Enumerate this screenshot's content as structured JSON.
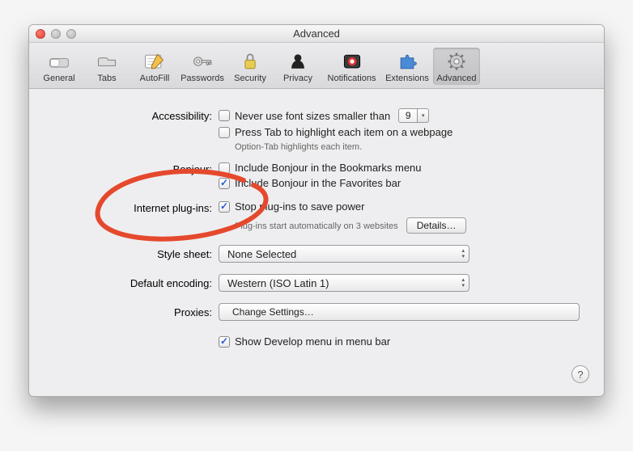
{
  "window": {
    "title": "Advanced"
  },
  "toolbar": {
    "items": [
      {
        "label": "General"
      },
      {
        "label": "Tabs"
      },
      {
        "label": "AutoFill"
      },
      {
        "label": "Passwords"
      },
      {
        "label": "Security"
      },
      {
        "label": "Privacy"
      },
      {
        "label": "Notifications"
      },
      {
        "label": "Extensions"
      },
      {
        "label": "Advanced"
      }
    ]
  },
  "sections": {
    "accessibility": {
      "label": "Accessibility:",
      "never_use_font_sizes": "Never use font sizes smaller than",
      "font_size_value": "9",
      "press_tab": "Press Tab to highlight each item on a webpage",
      "option_tab_note": "Option-Tab highlights each item."
    },
    "bonjour": {
      "label": "Bonjour:",
      "bookmarks": "Include Bonjour in the Bookmarks menu",
      "favorites": "Include Bonjour in the Favorites bar"
    },
    "plugins": {
      "label": "Internet plug-ins:",
      "stop": "Stop plug-ins to save power",
      "note": "Plug-ins start automatically on 3 websites",
      "details_button": "Details…"
    },
    "stylesheet": {
      "label": "Style sheet:",
      "value": "None Selected"
    },
    "encoding": {
      "label": "Default encoding:",
      "value": "Western (ISO Latin 1)"
    },
    "proxies": {
      "label": "Proxies:",
      "button": "Change Settings…"
    },
    "develop": {
      "label": "Show Develop menu in menu bar"
    }
  },
  "help_tooltip": "?"
}
